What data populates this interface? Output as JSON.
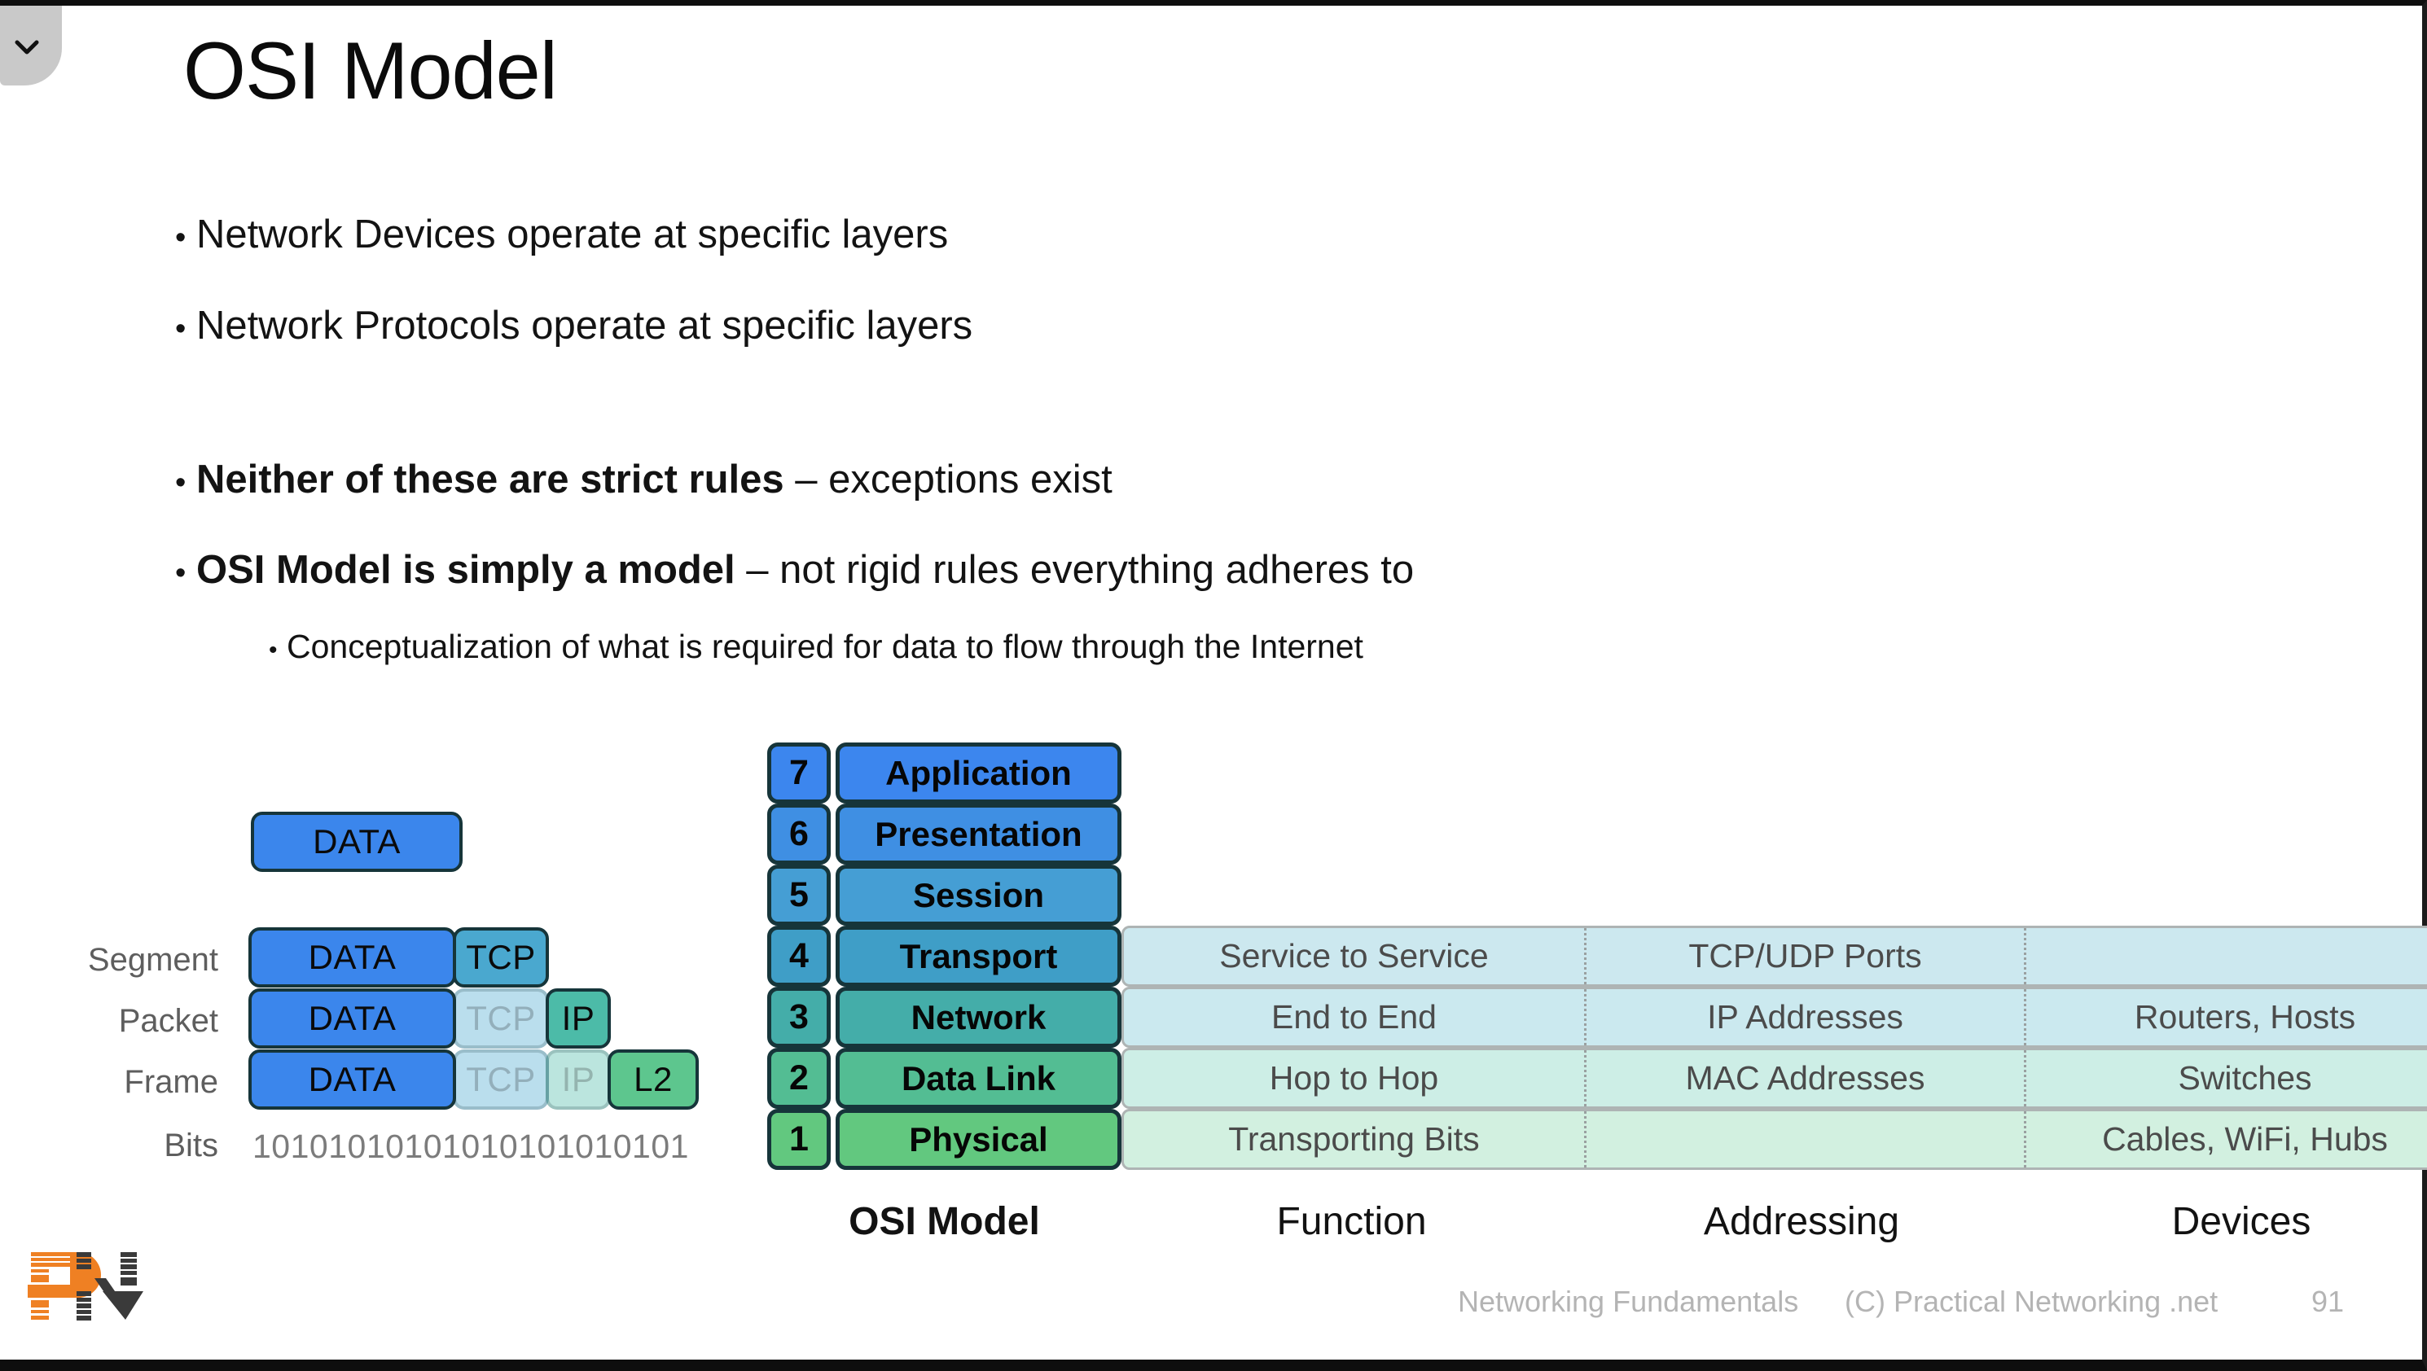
{
  "slide": {
    "title": "OSI Model",
    "collapse_icon": "chevron-down-icon"
  },
  "bullets": [
    {
      "text": "Network Devices operate at specific layers",
      "level": 1,
      "bold_prefix": ""
    },
    {
      "text": "Network Protocols operate at specific layers",
      "level": 1,
      "bold_prefix": ""
    },
    {
      "text": " – exceptions exist",
      "level": 1,
      "bold_prefix": "Neither of these are strict rules"
    },
    {
      "text": " – not rigid rules everything adheres to",
      "level": 1,
      "bold_prefix": "OSI Model is simply a model"
    },
    {
      "text": "Conceptualization of what is required for data to flow through the Internet",
      "level": 2,
      "bold_prefix": ""
    }
  ],
  "encapsulation": {
    "top_block_label": "DATA",
    "rows": [
      {
        "pdu": "Segment",
        "blocks": [
          {
            "label": "DATA",
            "kind": "data",
            "ghost": false
          },
          {
            "label": "TCP",
            "kind": "tcp",
            "ghost": false
          }
        ]
      },
      {
        "pdu": "Packet",
        "blocks": [
          {
            "label": "DATA",
            "kind": "data",
            "ghost": false
          },
          {
            "label": "TCP",
            "kind": "tcp",
            "ghost": true
          },
          {
            "label": "IP",
            "kind": "ip",
            "ghost": false
          }
        ]
      },
      {
        "pdu": "Frame",
        "blocks": [
          {
            "label": "DATA",
            "kind": "data",
            "ghost": false
          },
          {
            "label": "TCP",
            "kind": "tcp",
            "ghost": true
          },
          {
            "label": "IP",
            "kind": "ip",
            "ghost": true
          },
          {
            "label": "L2",
            "kind": "l2",
            "ghost": false
          }
        ]
      }
    ],
    "bits_label": "Bits",
    "bits_value": "10101010101010101010101"
  },
  "osi_layers": [
    {
      "number": "7",
      "name": "Application",
      "color": "#3c86ee"
    },
    {
      "number": "6",
      "name": "Presentation",
      "color": "#3f8fe3"
    },
    {
      "number": "5",
      "name": "Session",
      "color": "#459ed4"
    },
    {
      "number": "4",
      "name": "Transport",
      "color": "#3f9ec7"
    },
    {
      "number": "3",
      "name": "Network",
      "color": "#44ada9"
    },
    {
      "number": "2",
      "name": "Data Link",
      "color": "#53bd93"
    },
    {
      "number": "1",
      "name": "Physical",
      "color": "#62c87f"
    }
  ],
  "attribute_table": {
    "rows": [
      {
        "layer": "Transport",
        "function": "Service to Service",
        "addressing": "TCP/UDP Ports",
        "devices": "",
        "color": "#cce8ef"
      },
      {
        "layer": "Network",
        "function": "End to End",
        "addressing": "IP Addresses",
        "devices": "Routers, Hosts",
        "color": "#cbe9ef"
      },
      {
        "layer": "Data Link",
        "function": "Hop to Hop",
        "addressing": "MAC Addresses",
        "devices": "Switches",
        "color": "#cdeee6"
      },
      {
        "layer": "Physical",
        "function": "Transporting Bits",
        "addressing": "",
        "devices": "Cables, WiFi, Hubs",
        "color": "#d2f0e0"
      }
    ]
  },
  "column_captions": [
    {
      "label": "OSI Model",
      "strong": true
    },
    {
      "label": "Function",
      "strong": false
    },
    {
      "label": "Addressing",
      "strong": false
    },
    {
      "label": "Devices",
      "strong": false
    }
  ],
  "footer": {
    "course": "Networking Fundamentals",
    "copyright": "(C) Practical Networking .net",
    "page_number": "91",
    "logo": "practical-networking-pn-logo"
  },
  "colors": {
    "layer7": "#3c86ee",
    "layer1": "#62c87f",
    "data_block": "#3b86ec",
    "tcp_block": "#4aa8cf",
    "ip_block": "#4cbba8",
    "l2_block": "#5dc68e",
    "outline": "#16353a",
    "table_border": "#aeb4b4",
    "footer_text": "#b4b4b4",
    "logo_orange": "#ef8023",
    "logo_dark": "#3a3a3a"
  }
}
